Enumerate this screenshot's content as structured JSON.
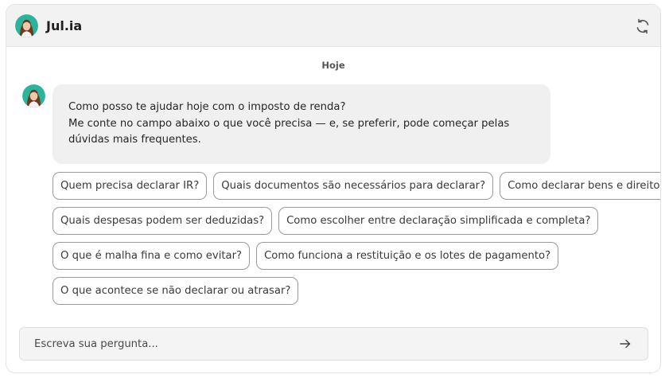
{
  "header": {
    "title": "Jul.ia",
    "avatar_icon": "woman-avatar-icon",
    "refresh_icon": "refresh-icon"
  },
  "chat": {
    "date_separator": "Hoje",
    "message_lines": [
      "Como posso te ajudar hoje com o imposto de renda?",
      "Me conte no campo abaixo o que você precisa — e, se preferir, pode começar pelas dúvidas mais frequentes."
    ]
  },
  "suggestions": [
    "Quem precisa declarar IR?",
    "Quais documentos são necessários para declarar?",
    "Como declarar bens e direitos?",
    "Quais despesas podem ser deduzidas?",
    "Como escolher entre declaração simplificada e completa?",
    "O que é malha fina e como evitar?",
    "Como funciona a restituição e os lotes de pagamento?",
    "O que acontece se não declarar ou atrasar?"
  ],
  "composer": {
    "placeholder": "Escreva sua pergunta...",
    "send_icon": "arrow-right-icon"
  },
  "colors": {
    "header_bg": "#f2f2f3",
    "bubble_bg": "#f0f0f1",
    "chip_border": "#9a9a9a",
    "avatar_bg": "#2bb39b"
  }
}
